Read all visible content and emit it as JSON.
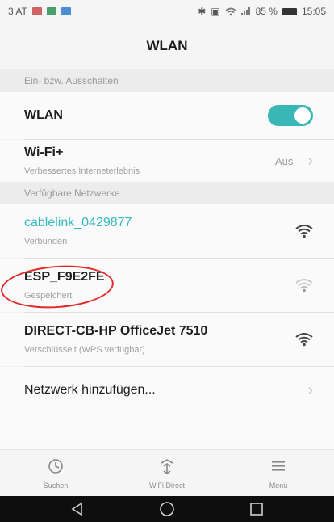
{
  "status_bar": {
    "carrier": "3 AT",
    "battery": "85 %",
    "time": "15:05",
    "colors": {
      "app1": "#d06464",
      "app2": "#4aa06a",
      "app3": "#4a8fd6"
    }
  },
  "title": "WLAN",
  "sections": {
    "switch": "Ein- bzw. Ausschalten",
    "available": "Verfügbare Netzwerke"
  },
  "wlan_toggle": {
    "label": "WLAN",
    "on": true,
    "accent": "#39b7b7"
  },
  "wifi_plus": {
    "label": "Wi-Fi+",
    "subtitle": "Verbessertes Interneterlebnis",
    "value": "Aus"
  },
  "networks": [
    {
      "name": "cablelink_0429877",
      "status": "Verbunden",
      "connected": true,
      "icon": "wifi-locked-icon"
    },
    {
      "name": "ESP_F9E2FE",
      "status": "Gespeichert",
      "connected": false,
      "icon": "wifi-weak-icon"
    },
    {
      "name": "DIRECT-CB-HP OfficeJet 7510",
      "status": "Verschlüsselt (WPS verfügbar)",
      "connected": false,
      "icon": "wifi-locked-icon"
    }
  ],
  "add_network": {
    "label": "Netzwerk hinzufügen..."
  },
  "bottom_nav": [
    {
      "label": "Suchen",
      "icon": "refresh-search-icon"
    },
    {
      "label": "WiFi Direct",
      "icon": "wifi-direct-icon"
    },
    {
      "label": "Menü",
      "icon": "menu-icon"
    }
  ],
  "system_nav": {
    "icons": [
      "back-icon",
      "home-icon",
      "recents-icon"
    ]
  }
}
